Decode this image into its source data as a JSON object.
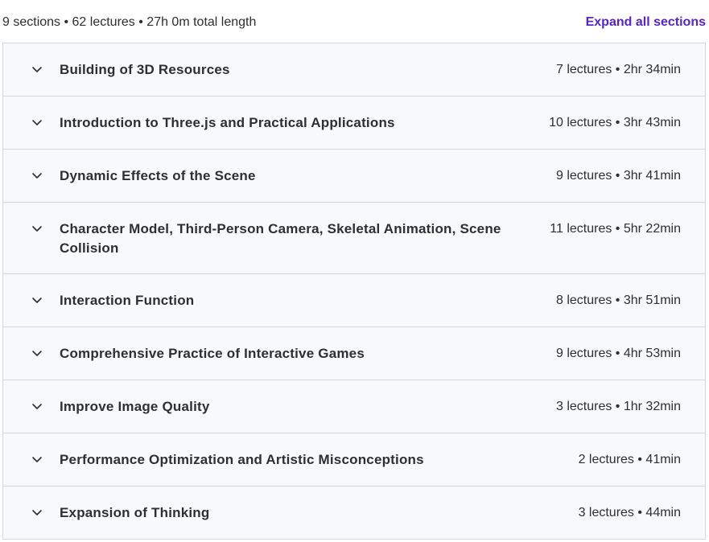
{
  "summary": {
    "text": "9 sections • 62 lectures • 27h 0m total length",
    "expand_all_label": "Expand all sections"
  },
  "colors": {
    "accent": "#5624d0",
    "row_background": "#f7f9fa",
    "border": "#d1d7dc",
    "text": "#2d2f31"
  },
  "sections": [
    {
      "title": "Building of 3D Resources",
      "meta": "7 lectures • 2hr 34min",
      "icon": "chevron-down-icon"
    },
    {
      "title": "Introduction to Three.js and Practical Applications",
      "meta": "10 lectures • 3hr 43min",
      "icon": "chevron-down-icon"
    },
    {
      "title": "Dynamic Effects of the Scene",
      "meta": "9 lectures • 3hr 41min",
      "icon": "chevron-down-icon"
    },
    {
      "title": "Character Model, Third-Person Camera, Skeletal Animation, Scene Collision",
      "meta": "11 lectures • 5hr 22min",
      "icon": "chevron-down-icon"
    },
    {
      "title": "Interaction Function",
      "meta": "8 lectures • 3hr 51min",
      "icon": "chevron-down-icon"
    },
    {
      "title": "Comprehensive Practice of Interactive Games",
      "meta": "9 lectures • 4hr 53min",
      "icon": "chevron-down-icon"
    },
    {
      "title": "Improve Image Quality",
      "meta": "3 lectures • 1hr 32min",
      "icon": "chevron-down-icon"
    },
    {
      "title": "Performance Optimization and Artistic Misconceptions",
      "meta": "2 lectures • 41min",
      "icon": "chevron-down-icon"
    },
    {
      "title": "Expansion of Thinking",
      "meta": "3 lectures • 44min",
      "icon": "chevron-down-icon"
    }
  ]
}
